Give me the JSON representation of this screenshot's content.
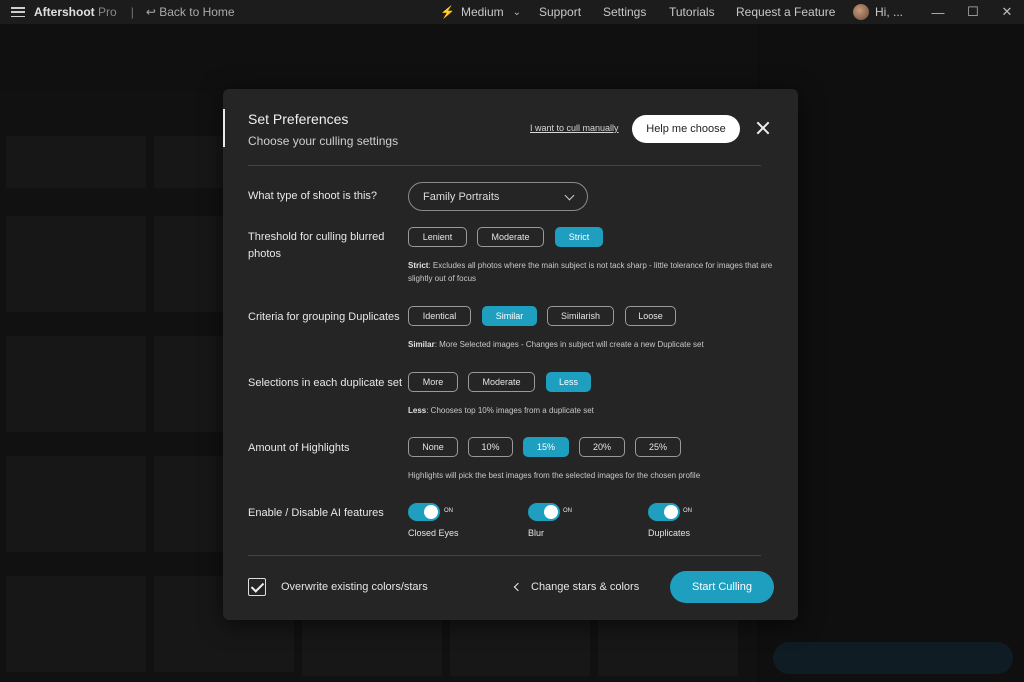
{
  "topbar": {
    "brand": "Aftershoot",
    "brand_suffix": "Pro",
    "separator": "|",
    "back_label": "Back to Home",
    "speed_label": "Medium",
    "support_label": "Support",
    "settings_label": "Settings",
    "tutorials_label": "Tutorials",
    "request_label": "Request a Feature",
    "user_label": "Hi, ..."
  },
  "modal": {
    "title": "Set Preferences",
    "subtitle": "Choose your culling settings",
    "manual_link": "I want to cull manually",
    "help_button": "Help me choose",
    "shoot_type": {
      "label": "What type of shoot is this?",
      "selected": "Family Portraits"
    },
    "blur": {
      "label": "Threshold for culling blurred photos",
      "options": [
        "Lenient",
        "Moderate",
        "Strict"
      ],
      "selected": "Strict",
      "desc_key": "Strict",
      "desc_text": ": Excludes all photos where the main subject is not tack sharp - little tolerance for images that are slightly out of focus"
    },
    "duplicates": {
      "label": "Criteria for grouping Duplicates",
      "options": [
        "Identical",
        "Similar",
        "Similarish",
        "Loose"
      ],
      "selected": "Similar",
      "desc_key": "Similar",
      "desc_text": ": More Selected images - Changes in subject will create a new Duplicate set"
    },
    "selections": {
      "label": "Selections in each duplicate set",
      "options": [
        "More",
        "Moderate",
        "Less"
      ],
      "selected": "Less",
      "desc_key": "Less",
      "desc_text": ": Chooses top 10% images from a duplicate set"
    },
    "highlights": {
      "label": "Amount of Highlights",
      "options": [
        "None",
        "10%",
        "15%",
        "20%",
        "25%"
      ],
      "selected": "15%",
      "desc_text": "Highlights will pick the best images from the selected images for the chosen profile"
    },
    "ai": {
      "label": "Enable / Disable AI features",
      "on_text": "ON",
      "toggles": [
        "Closed Eyes",
        "Blur",
        "Duplicates"
      ],
      "state": [
        true,
        true,
        true
      ]
    },
    "overwrite_label": "Overwrite existing colors/stars",
    "overwrite_checked": true,
    "change_link": "Change stars & colors",
    "start_button": "Start Culling"
  },
  "colors": {
    "accent": "#1e9fc0",
    "modal_bg": "#252525"
  }
}
